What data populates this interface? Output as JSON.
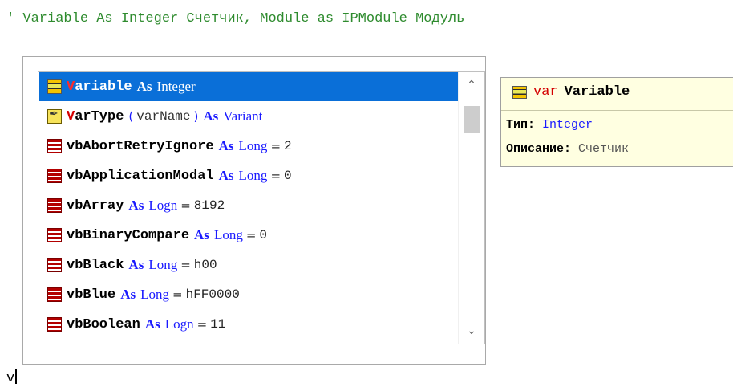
{
  "editor": {
    "comment_line": "' Variable As Integer Счетчик, Module as IPModule Модуль",
    "current_line": "v"
  },
  "completion": {
    "items": [
      {
        "icon": "variable-icon",
        "first": "V",
        "rest": "ariable",
        "kw": "As",
        "type": "Integer",
        "selected": true
      },
      {
        "icon": "function-icon",
        "first": "V",
        "rest": "arType",
        "arg": "varName",
        "kw": "As",
        "type": "Variant"
      },
      {
        "icon": "constant-icon",
        "name": "vbAbortRetryIgnore",
        "kw": "As",
        "type": "Long",
        "value": "2"
      },
      {
        "icon": "constant-icon",
        "name": "vbApplicationModal",
        "kw": "As",
        "type": "Long",
        "value": "0"
      },
      {
        "icon": "constant-icon",
        "name": "vbArray",
        "kw": "As",
        "type": "Logn",
        "value": "8192"
      },
      {
        "icon": "constant-icon",
        "name": "vbBinaryCompare",
        "kw": "As",
        "type": "Long",
        "value": "0"
      },
      {
        "icon": "constant-icon",
        "name": "vbBlack",
        "kw": "As",
        "type": "Long",
        "value": "h00"
      },
      {
        "icon": "constant-icon",
        "name": "vbBlue",
        "kw": "As",
        "type": "Long",
        "value": "hFF0000"
      },
      {
        "icon": "constant-icon",
        "name": "vbBoolean",
        "kw": "As",
        "type": "Logn",
        "value": "11"
      }
    ],
    "scroll_up": "⌃",
    "scroll_down": "⌄"
  },
  "tooltip": {
    "keyword": "var",
    "name": "Variable",
    "type_label": "Тип:",
    "type_value": "Integer",
    "desc_label": "Описание:",
    "desc_value": "Счетчик"
  }
}
